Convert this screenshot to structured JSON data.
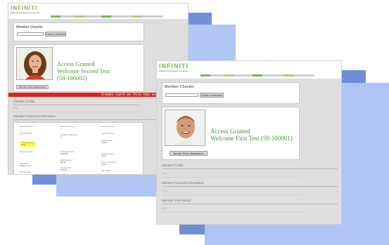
{
  "screens": [
    {
      "logo_word": "INFINITI",
      "logo_tagline": "National Acceptance Company",
      "checkin_title": "Member Checkin",
      "checkin_button": "Check In Member",
      "status": "Access Granted",
      "welcome": "Welcome Second Test",
      "member_id": "(59-100002)",
      "photo_button": "Member Photo Maintenance",
      "alert": "Credit Card on file has expired",
      "profile_section": "Member Profile",
      "profile_placeholder": "[+/-]",
      "financial_section": "Member Financial Information",
      "financial_fields": [
        {
          "label": "Payment Method",
          "value": ""
        },
        {
          "label": "Days Remaining",
          "value": "0"
        },
        {
          "label": "Month to Month",
          "value": ""
        },
        {
          "label": "Next Draft Date",
          "value": ""
        },
        {
          "label": "Number of Payments",
          "value": "0"
        },
        {
          "label": "Contract Status",
          "value": ""
        },
        {
          "label": "Credit Card Exp.",
          "value": "08/14"
        },
        {
          "label": "Contract Type",
          "value": "Classic"
        },
        {
          "label": "Routing Number",
          "value": ""
        },
        {
          "label": "Contract Amount",
          "value": "$1201.00"
        },
        {
          "label": "Date Last Paid",
          "value": "$0.00"
        },
        {
          "label": "Draft Payment",
          "value": "$65.00"
        },
        {
          "label": "Amount Last Paid",
          "value": "$0.00"
        },
        {
          "label": "Start Date",
          "value": "1/2016 1:1:00"
        },
        {
          "label": "Contract Bal.",
          "value": "$301.00"
        },
        {
          "label": "Late Status",
          "value": ""
        },
        {
          "label": "Renewal Date",
          "value": ""
        }
      ]
    },
    {
      "logo_word": "INFINITI",
      "logo_tagline": "National Acceptance Company",
      "checkin_title": "Member Checkin",
      "checkin_button": "Check In Member",
      "status": "Access Granted",
      "welcome": "Welcome First Test",
      "member_id": "(59-100001)",
      "photo_button": "Member Photo Maintenance",
      "profile_section": "Member Profile",
      "profile_placeholder": "[+/-]",
      "financial_section": "Member Financial Information",
      "financial_placeholder": "[+/-]",
      "history_section": "Member Visit History",
      "history_placeholder": "[+/-]"
    }
  ],
  "colors": {
    "accent_blue": "#6f8fd8",
    "light_blue": "#aec4f5",
    "logo_green": "#7cb84a",
    "welcome_green": "#3f9a2e",
    "alert_red": "#e02020"
  },
  "stripe_colors": [
    "#7cb84a",
    "#a9d07e",
    "#cfcfcf",
    "#7cb84a",
    "#a9d07e",
    "#cfcfcf",
    "#7cb84a"
  ]
}
